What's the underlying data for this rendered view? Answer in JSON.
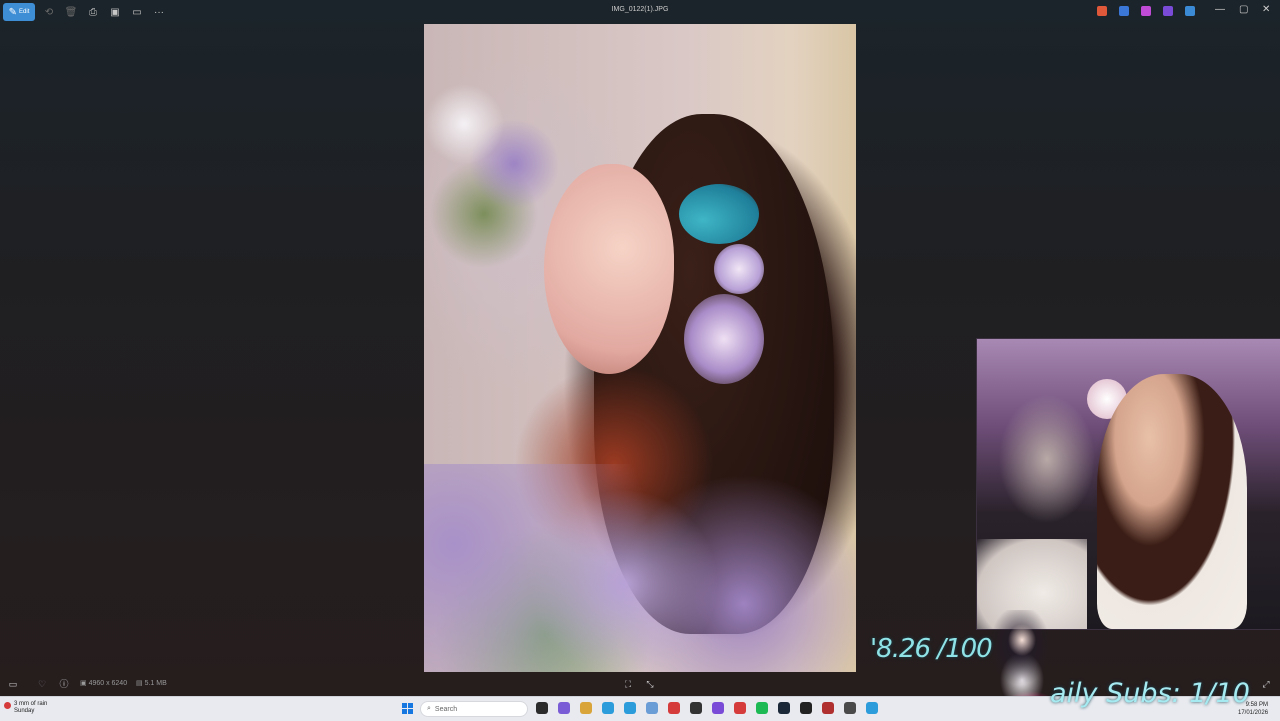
{
  "window": {
    "file_title": "IMG_0122(1).JPG",
    "edit_label": "Edit",
    "more_label": "···"
  },
  "viewer_info": {
    "dimensions": "4960 x 6240",
    "file_size": "5.1 MB"
  },
  "overlay": {
    "goal_text": "'8.26 /100",
    "subs_text": "aily Subs: 1/10"
  },
  "taskbar": {
    "weather_line1": "3 mm of rain",
    "weather_line2": "Sunday",
    "search_placeholder": "Search",
    "time": "9:58 PM",
    "date": "17/01/2026",
    "colors": {
      "start": "#1677e0",
      "app1": "#2b2b2b",
      "app2": "#d9a43a",
      "app3": "#2d9cdb",
      "app4": "#d63b3b",
      "app5": "#1db954",
      "app6": "#222222"
    }
  },
  "theme": {
    "accent": "#3e8ed6",
    "overlay_text": "#8fe3e6"
  }
}
